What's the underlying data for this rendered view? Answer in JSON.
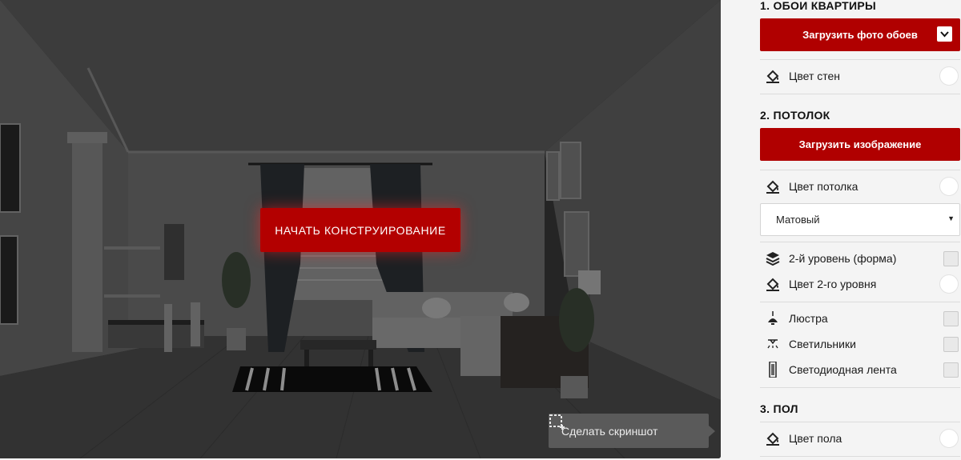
{
  "scene": {
    "start_button_label": "НАЧАТЬ КОНСТРУИРОВАНИЕ",
    "screenshot_button_label": "Сделать скриншот"
  },
  "panel": {
    "wallpaper": {
      "title": "1. ОБОИ КВАРТИРЫ",
      "upload_label": "Загрузить фото обоев",
      "wall_color_label": "Цвет стен"
    },
    "ceiling": {
      "title": "2. ПОТОЛОК",
      "upload_label": "Загрузить изображение",
      "ceiling_color_label": "Цвет потолка",
      "finish_selected": "Матовый",
      "second_level_label": "2-й уровень (форма)",
      "second_level_color_label": "Цвет 2-го уровня",
      "chandelier_label": "Люстра",
      "lamps_label": "Светильники",
      "led_strip_label": "Светодиодная лента"
    },
    "floor": {
      "title": "3. ПОЛ",
      "floor_color_label": "Цвет пола"
    }
  },
  "colors": {
    "accent": "#b00000",
    "panel_bg": "#f4f4f4",
    "scene_overlay": "#3a3a3a"
  }
}
